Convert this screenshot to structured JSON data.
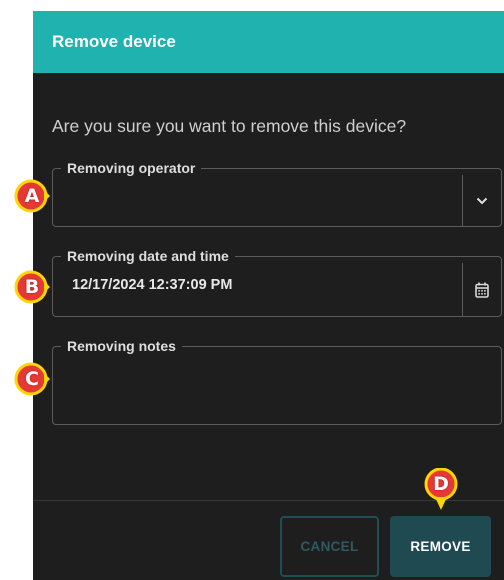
{
  "dialog": {
    "title": "Remove device",
    "question": "Are you sure you want to remove this device?",
    "header_color": "#20b2ae"
  },
  "fields": {
    "operator": {
      "label": "Removing operator",
      "value": "",
      "icon": "chevron-down-icon"
    },
    "datetime": {
      "label": "Removing date and time",
      "value": "12/17/2024 12:37:09 PM",
      "icon": "calendar-icon"
    },
    "notes": {
      "label": "Removing notes",
      "value": ""
    }
  },
  "buttons": {
    "cancel": "CANCEL",
    "remove": "REMOVE"
  },
  "markers": [
    "A",
    "B",
    "C",
    "D"
  ]
}
